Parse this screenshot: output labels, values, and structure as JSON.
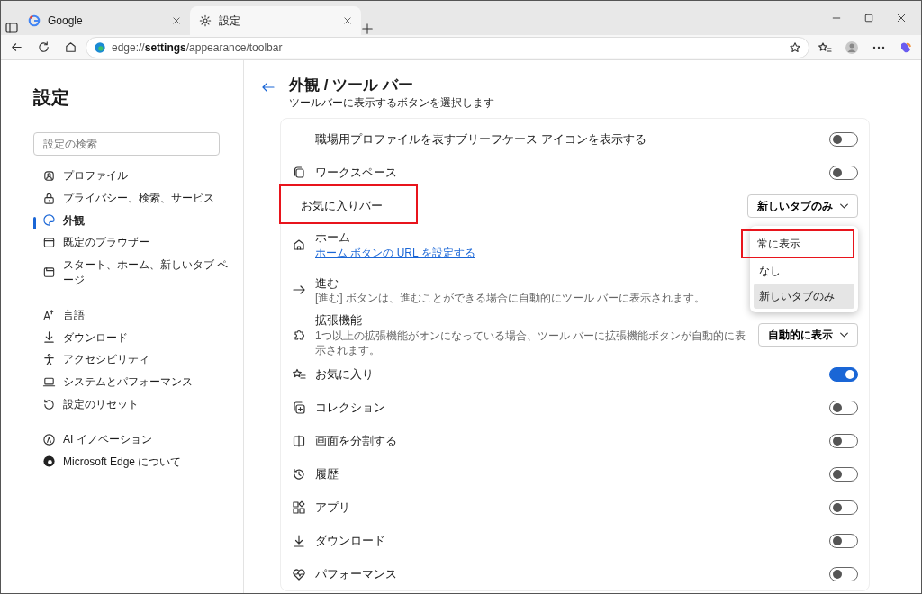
{
  "window": {
    "tabs": [
      {
        "title": "Google",
        "selected": false
      },
      {
        "title": "設定",
        "selected": true
      }
    ]
  },
  "address_bar": {
    "url": "edge://**settings**/appearance/toolbar"
  },
  "sidebar": {
    "title": "設定",
    "search": {
      "placeholder": "設定の検索"
    },
    "groups": [
      [
        {
          "label": "プロファイル",
          "selected": false
        },
        {
          "label": "プライバシー、検索、サービス",
          "selected": false
        },
        {
          "label": "外観",
          "selected": true
        },
        {
          "label": "既定のブラウザー",
          "selected": false
        },
        {
          "label": "スタート、ホーム、新しいタブ ページ",
          "selected": false
        }
      ],
      [
        {
          "label": "言語",
          "selected": false
        },
        {
          "label": "ダウンロード",
          "selected": false
        },
        {
          "label": "アクセシビリティ",
          "selected": false
        },
        {
          "label": "システムとパフォーマンス",
          "selected": false
        },
        {
          "label": "設定のリセット",
          "selected": false
        }
      ],
      [
        {
          "label": "AI イノベーション",
          "selected": false
        },
        {
          "label": "Microsoft Edge について",
          "selected": false
        }
      ]
    ]
  },
  "page": {
    "title": "外観 / ツール バー",
    "subtitle": "ツールバーに表示するボタンを選択します",
    "rows": [
      {
        "kind": "toggle",
        "label": "職場用プロファイルを表すブリーフケース アイコンを表示する",
        "on": false
      },
      {
        "kind": "toggle",
        "label": "ワークスペース",
        "on": false
      },
      {
        "kind": "dropdown",
        "label": "お気に入りバー",
        "value": "新しいタブのみ",
        "highlighted": true
      },
      {
        "kind": "link",
        "label": "ホーム",
        "link": "ホーム ボタンの URL を設定する"
      },
      {
        "kind": "info",
        "label": "進む",
        "description": "[進む] ボタンは、進むことができる場合に自動的にツール バーに表示されます。"
      },
      {
        "kind": "dropdown",
        "label": "拡張機能",
        "description": "1つ以上の拡張機能がオンになっている場合、ツール バーに拡張機能ボタンが自動的に表示されます。",
        "value": "自動的に表示",
        "highlighted": false
      },
      {
        "kind": "toggle",
        "label": "お気に入り",
        "on": true
      },
      {
        "kind": "toggle",
        "label": "コレクション",
        "on": false
      },
      {
        "kind": "toggle",
        "label": "画面を分割する",
        "on": false
      },
      {
        "kind": "toggle",
        "label": "履歴",
        "on": false
      },
      {
        "kind": "toggle",
        "label": "アプリ",
        "on": false
      },
      {
        "kind": "toggle",
        "label": "ダウンロード",
        "on": false
      },
      {
        "kind": "toggle",
        "label": "パフォーマンス",
        "on": false
      }
    ],
    "dropdown_menu": {
      "options": [
        {
          "label": "常に表示",
          "selected": false,
          "highlighted": true
        },
        {
          "label": "なし",
          "selected": false,
          "highlighted": false
        },
        {
          "label": "新しいタブのみ",
          "selected": true,
          "highlighted": false
        }
      ]
    }
  }
}
